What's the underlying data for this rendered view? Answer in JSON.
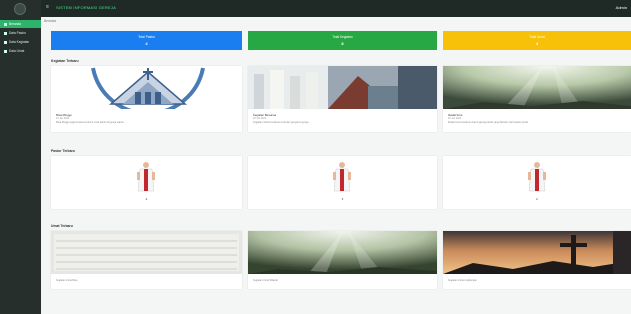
{
  "sidebar": {
    "items": [
      {
        "label": "Beranda"
      },
      {
        "label": "Data Pastor"
      },
      {
        "label": "Data Kegiatan"
      },
      {
        "label": "Data Umat"
      }
    ]
  },
  "topbar": {
    "title": "SISTEM INFORMASI GEREJA",
    "user": "Admin"
  },
  "breadcrumb": "Beranda",
  "stats": [
    {
      "title": "Total Pastor",
      "value": "4",
      "color": "#1a7ef0"
    },
    {
      "title": "Total Kegiatan",
      "value": "8",
      "color": "#27a845"
    },
    {
      "title": "Total Umat",
      "value": "4",
      "color": "#f7c10a"
    }
  ],
  "sections": {
    "kegiatan": "Kegiatan Terbaru",
    "pastor": "Pastor Terbaru",
    "umat": "Umat Terbaru"
  },
  "kegiatan_cards": [
    {
      "title": "Misa Minggu",
      "date": "12 Jan 2024",
      "desc": "Misa Minggu pagi bersama seluruh umat paroki di gereja utama."
    },
    {
      "title": "Kegiatan Bersama",
      "date": "18 Jan 2024",
      "desc": "Kegiatan rohani bersama umat dan pengurus gereja."
    },
    {
      "title": "Ibadat Sore",
      "date": "20 Jan 2024",
      "desc": "Ibadat sore bersama umat di gereja paroki yang dipimpin oleh pastor paroki."
    }
  ],
  "pastor_cards": [
    {
      "number": "4"
    },
    {
      "number": "3"
    },
    {
      "number": "2"
    }
  ],
  "umat_cards": [
    {
      "caption": "Kegiatan Umat Baru"
    },
    {
      "caption": "Kegiatan Umat Wilayah"
    },
    {
      "caption": "Kegiatan Umat Lingkungan"
    }
  ]
}
